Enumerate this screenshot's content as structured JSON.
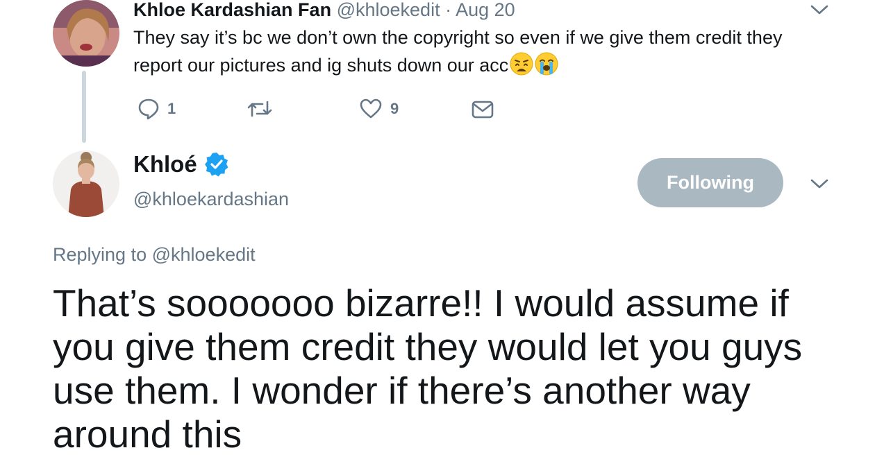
{
  "parent_tweet": {
    "display_name": "Khloe Kardashian Fan",
    "handle": "@khloekedit",
    "separator": "·",
    "date": "Aug 20",
    "text": "They say it’s bc we don’t own the copyright so even if we give them credit they report our pictures and ig shuts down our acc",
    "emojis": [
      "weary-face-icon",
      "loudly-crying-face-icon"
    ],
    "reply_count": "1",
    "like_count": "9"
  },
  "main_tweet": {
    "display_name": "Khloé",
    "verified": true,
    "handle": "@khloekardashian",
    "follow_label": "Following",
    "replying_prefix": "Replying to",
    "replying_handle": "@khloekedit",
    "text": "That’s sooooooo bizarre!! I would assume if you give them credit they would let you guys use them. I wonder if there’s another way around this"
  },
  "colors": {
    "text": "#14171a",
    "muted": "#657786",
    "following_button": "#aab8c2",
    "verified_badge": "#1da1f2",
    "thread_line": "#ccd6dd"
  }
}
